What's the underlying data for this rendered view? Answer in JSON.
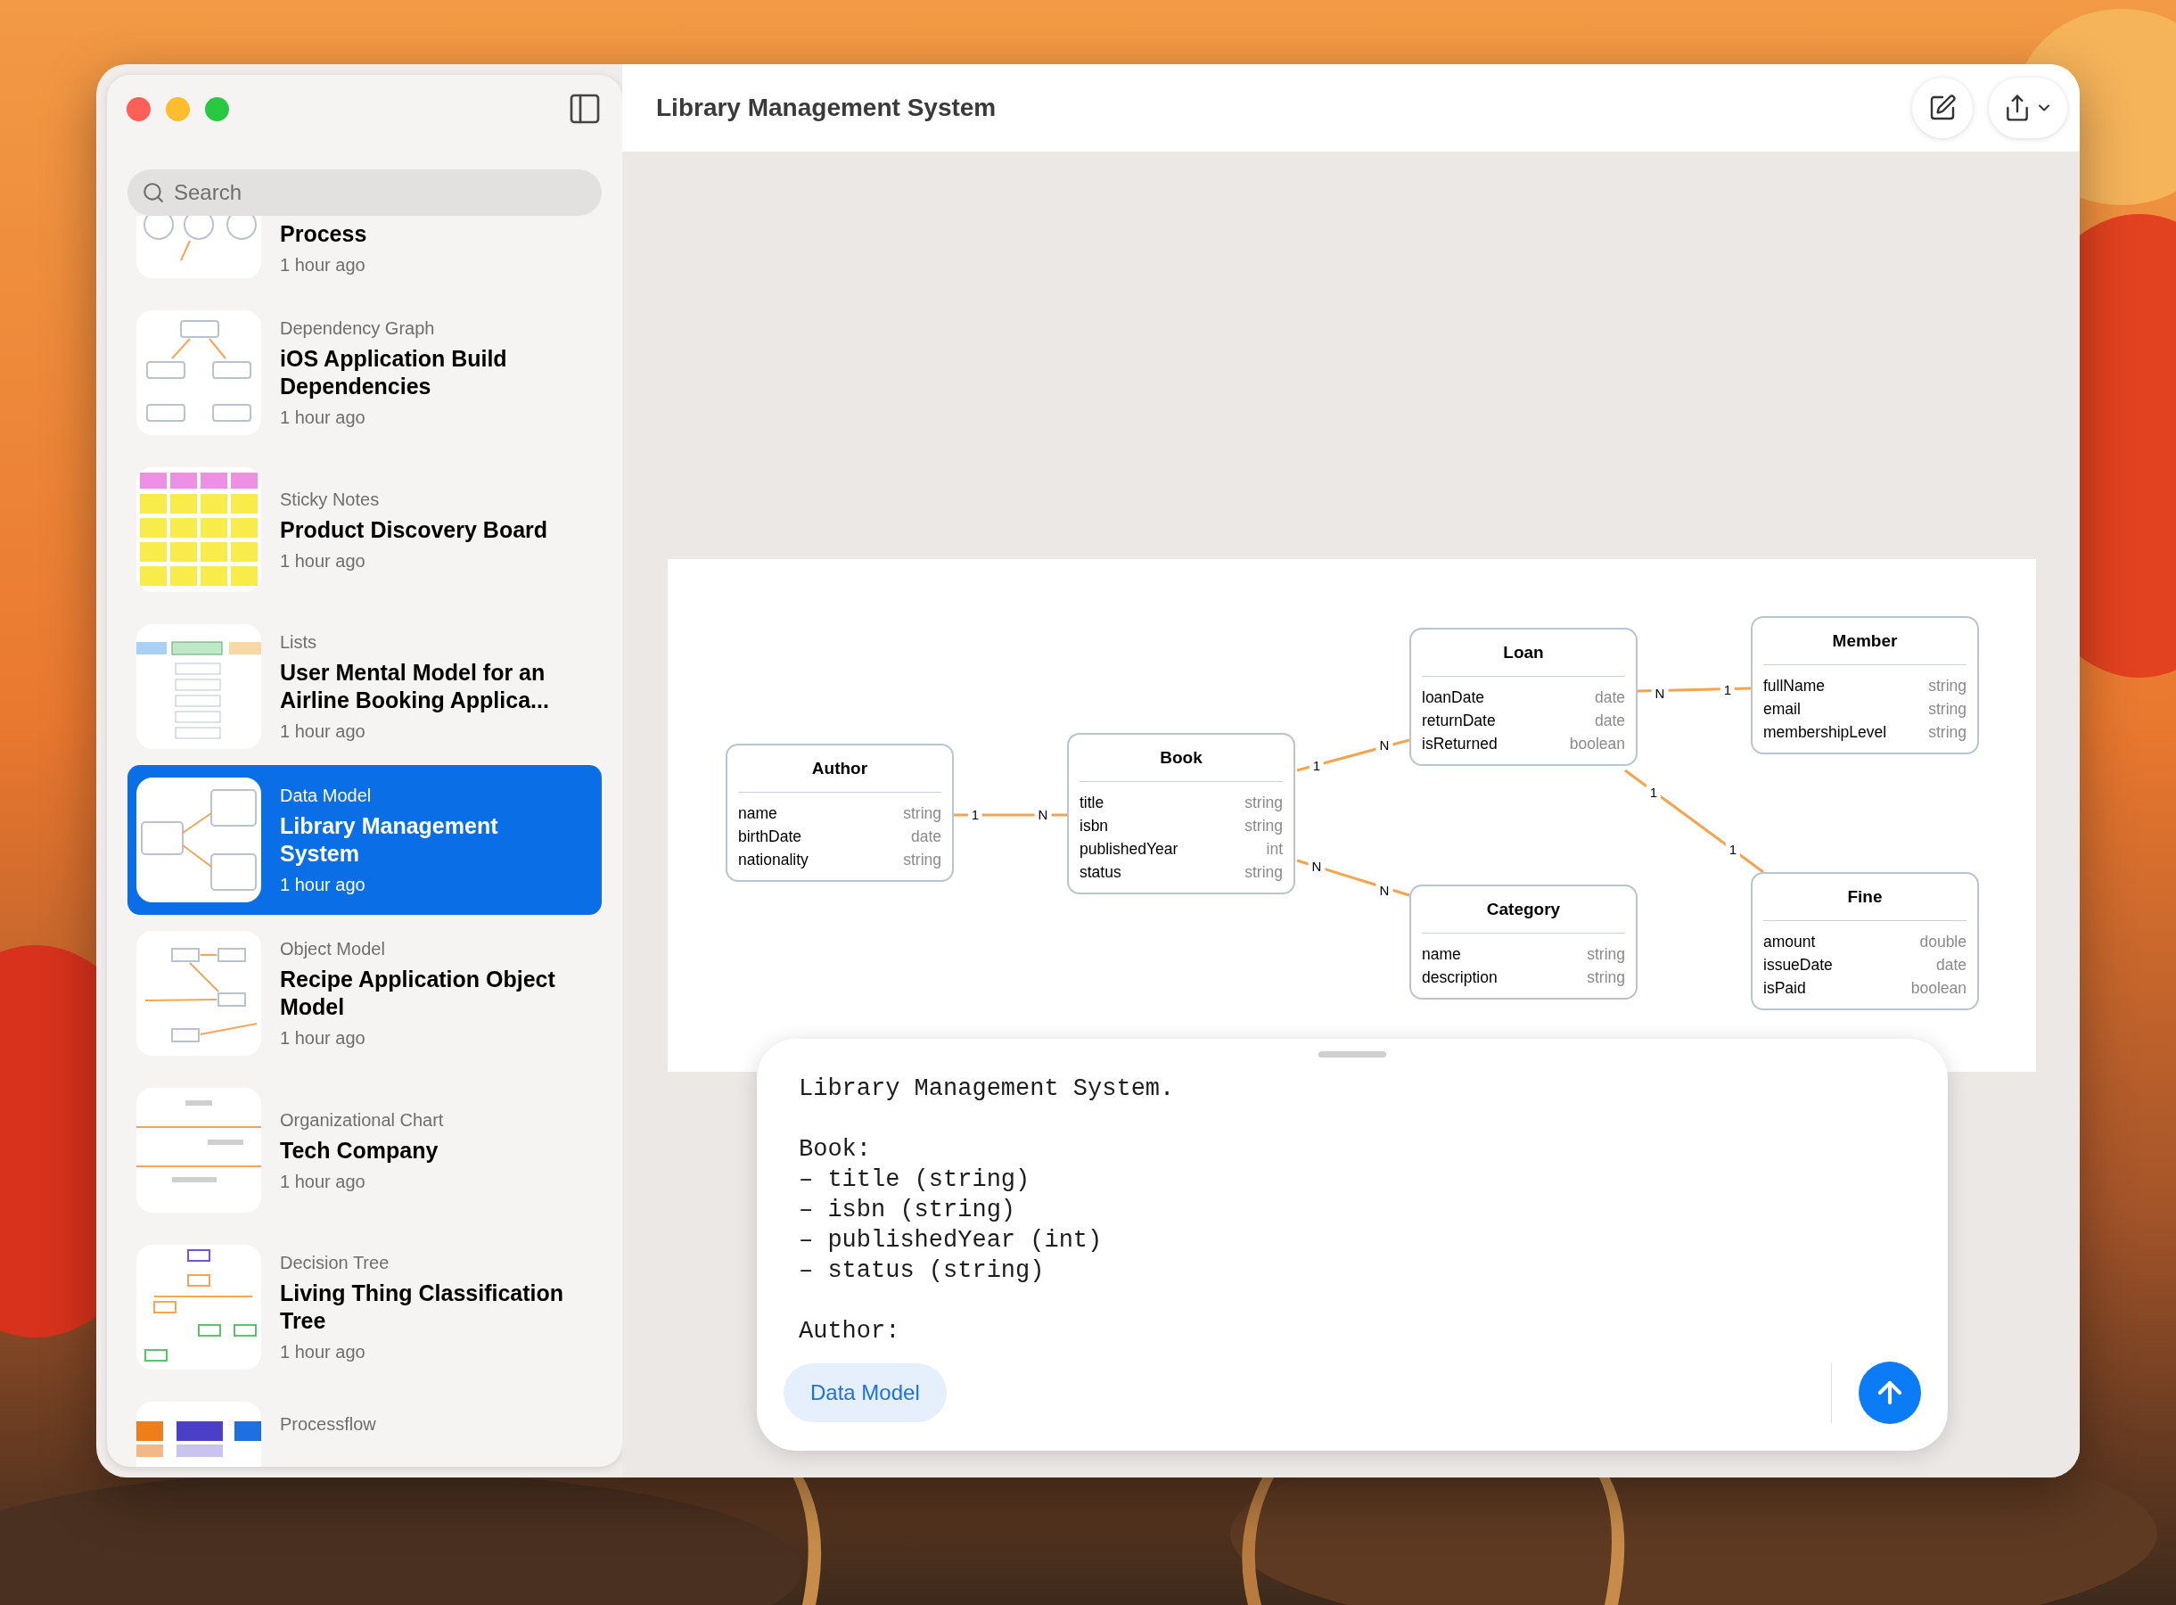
{
  "window": {
    "title": "Library Management System"
  },
  "sidebar": {
    "search": {
      "placeholder": "Search"
    },
    "items": [
      {
        "kind": "graph",
        "title": "Process",
        "time": "1 hour ago",
        "selected": false
      },
      {
        "kind": "tree",
        "category": "Dependency Graph",
        "title": "iOS Application Build Dependencies",
        "time": "1 hour ago",
        "selected": false
      },
      {
        "kind": "sticky",
        "category": "Sticky Notes",
        "title": "Product Discovery Board",
        "time": "1 hour ago",
        "selected": false
      },
      {
        "kind": "lists",
        "category": "Lists",
        "title": "User Mental Model for an Airline Booking Applica...",
        "time": "1 hour ago",
        "selected": false
      },
      {
        "kind": "datamodel",
        "category": "Data Model",
        "title": "Library Management System",
        "time": "1 hour ago",
        "selected": true
      },
      {
        "kind": "objectmodel",
        "category": "Object Model",
        "title": "Recipe Application Object Model",
        "time": "1 hour ago",
        "selected": false
      },
      {
        "kind": "org",
        "category": "Organizational Chart",
        "title": "Tech Company",
        "time": "1 hour ago",
        "selected": false
      },
      {
        "kind": "decision",
        "category": "Decision Tree",
        "title": "Living Thing Classification Tree",
        "time": "1 hour ago",
        "selected": false
      },
      {
        "kind": "flow",
        "category": "Processflow",
        "selected": false
      }
    ]
  },
  "diagram": {
    "entities": [
      {
        "name": "Author",
        "fields": [
          {
            "name": "name",
            "type": "string"
          },
          {
            "name": "birthDate",
            "type": "date"
          },
          {
            "name": "nationality",
            "type": "string"
          }
        ]
      },
      {
        "name": "Book",
        "fields": [
          {
            "name": "title",
            "type": "string"
          },
          {
            "name": "isbn",
            "type": "string"
          },
          {
            "name": "publishedYear",
            "type": "int"
          },
          {
            "name": "status",
            "type": "string"
          }
        ]
      },
      {
        "name": "Loan",
        "fields": [
          {
            "name": "loanDate",
            "type": "date"
          },
          {
            "name": "returnDate",
            "type": "date"
          },
          {
            "name": "isReturned",
            "type": "boolean"
          }
        ]
      },
      {
        "name": "Member",
        "fields": [
          {
            "name": "fullName",
            "type": "string"
          },
          {
            "name": "email",
            "type": "string"
          },
          {
            "name": "membershipLevel",
            "type": "string"
          }
        ]
      },
      {
        "name": "Category",
        "fields": [
          {
            "name": "name",
            "type": "string"
          },
          {
            "name": "description",
            "type": "string"
          }
        ]
      },
      {
        "name": "Fine",
        "fields": [
          {
            "name": "amount",
            "type": "double"
          },
          {
            "name": "issueDate",
            "type": "date"
          },
          {
            "name": "isPaid",
            "type": "boolean"
          }
        ]
      }
    ],
    "relations": [
      {
        "labels": [
          "1",
          "N"
        ]
      },
      {
        "labels": [
          "1",
          "N"
        ]
      },
      {
        "labels": [
          "N",
          "N"
        ]
      },
      {
        "labels": [
          "N",
          "1"
        ]
      },
      {
        "labels": [
          "1",
          "1"
        ]
      }
    ]
  },
  "prompt": {
    "value": "Library Management System.\n\nBook:\n– title (string)\n– isbn (string)\n– publishedYear (int)\n– status (string)\n\nAuthor:",
    "chip": "Data Model"
  }
}
